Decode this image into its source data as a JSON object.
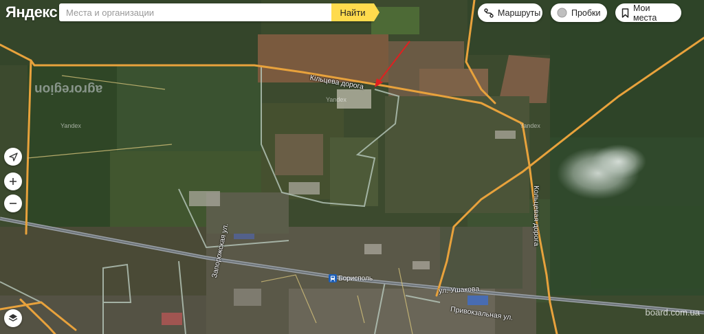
{
  "logo": "Яндекс",
  "search": {
    "placeholder": "Места и организации",
    "value": "",
    "button_label": "Найти"
  },
  "top_buttons": {
    "routes": "Маршруты",
    "traffic": "Пробки",
    "my_places": "Мои места"
  },
  "map": {
    "road_labels": {
      "kiltseva_ua": "Кільцева дорога",
      "koltsevaya_ru": "Кольцевая дорога",
      "ushakova": "ул. Ушакова",
      "privokzalnaya": "Привокзальная ул.",
      "zaporozhskaya": "Запорожская ул."
    },
    "station_label": "Борисполь",
    "station_icon": "railway-station-icon",
    "field_text": "agroregion",
    "yandex_watermark": "Yandex"
  },
  "watermark": "board.com.ua",
  "colors": {
    "search_button": "#ffdb4d",
    "road": "#e8a23c",
    "boundary": "#b8c9bd",
    "arrow": "#e02020"
  }
}
